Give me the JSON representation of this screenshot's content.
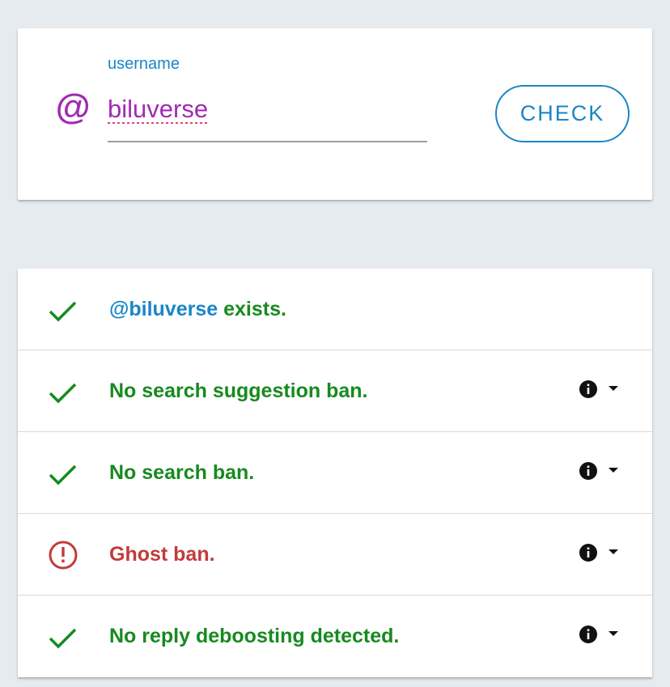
{
  "colors": {
    "background": "#e6ebf0",
    "card": "#ffffff",
    "accent_blue": "#1a86c7",
    "purple": "#a22ab3",
    "success_green": "#178a1f",
    "error_red": "#c23b3b",
    "icon_black": "#111111"
  },
  "search": {
    "at_symbol": "@",
    "label": "username",
    "value": "biluverse",
    "button_label": "CHECK"
  },
  "results": [
    {
      "status": "success",
      "icon": "check-icon",
      "handle": "@biluverse",
      "text": " exists.",
      "has_info": false
    },
    {
      "status": "success",
      "icon": "check-icon",
      "text": "No search suggestion ban.",
      "has_info": true,
      "info_icon": "info-icon",
      "toggle_icon": "caret-down-icon"
    },
    {
      "status": "success",
      "icon": "check-icon",
      "text": "No search ban.",
      "has_info": true,
      "info_icon": "info-icon",
      "toggle_icon": "caret-down-icon"
    },
    {
      "status": "error",
      "icon": "alert-circle-icon",
      "text": "Ghost ban.",
      "has_info": true,
      "info_icon": "info-icon",
      "toggle_icon": "caret-down-icon"
    },
    {
      "status": "success",
      "icon": "check-icon",
      "text": "No reply deboosting detected.",
      "has_info": true,
      "info_icon": "info-icon",
      "toggle_icon": "caret-down-icon"
    }
  ]
}
